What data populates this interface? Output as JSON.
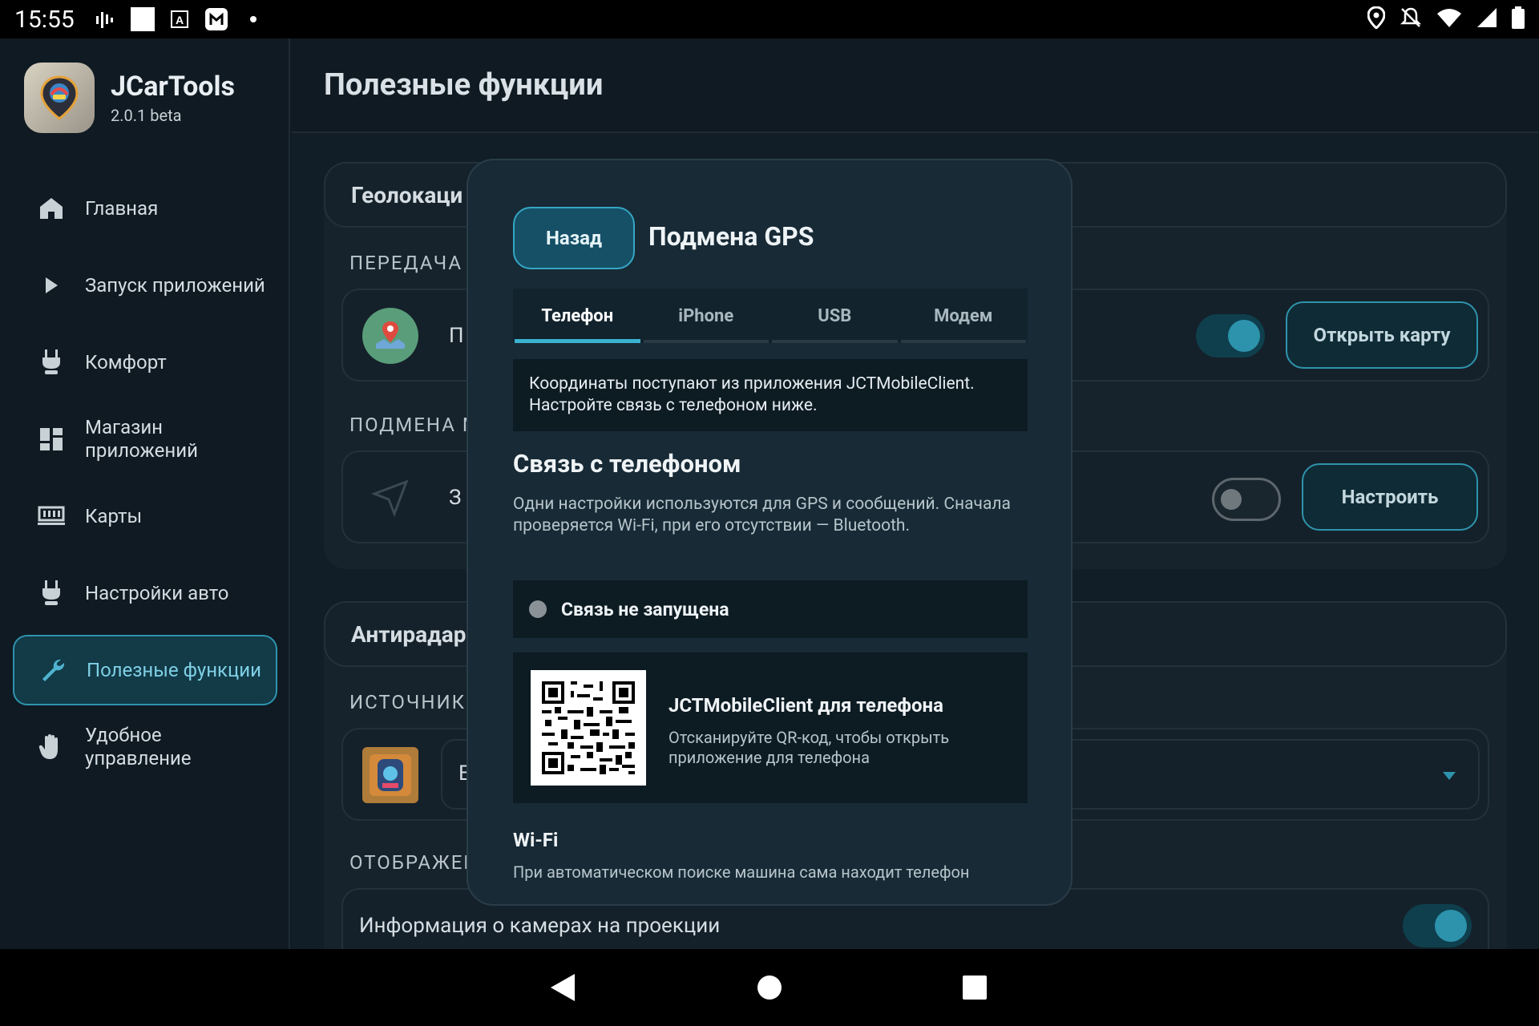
{
  "status_bar": {
    "time": "15:55"
  },
  "sidebar": {
    "app_name": "JCarTools",
    "version": "2.0.1 beta",
    "items": [
      {
        "label": "Главная",
        "icon": "home-icon"
      },
      {
        "label": "Запуск приложений",
        "icon": "play-icon"
      },
      {
        "label": "Комфорт",
        "icon": "seat-icon"
      },
      {
        "label": "Магазин\nприложений",
        "icon": "grid-icon"
      },
      {
        "label": "Карты",
        "icon": "map-icon"
      },
      {
        "label": "Настройки авто",
        "icon": "seat-icon"
      },
      {
        "label": "Полезные функции",
        "icon": "wrench-icon",
        "active": true
      },
      {
        "label": "Удобное\nуправление",
        "icon": "hand-icon"
      }
    ]
  },
  "main": {
    "title": "Полезные функции",
    "geo_card": {
      "header": "Геолокаци",
      "section1": "ПЕРЕДАЧА",
      "row1_text": "П",
      "row1_button": "Открыть карту",
      "section2": "ПОДМЕНА М",
      "row2_text": "З",
      "row2_button": "Настроить"
    },
    "radar_card": {
      "header": "Антирадар",
      "section1": "ИСТОЧНИК",
      "row1_text": "E",
      "section2": "ОТОБРАЖЕНИЕ ПРЕДУПРЕЖДЕНИЙ",
      "row2_text": "Информация о камерах на проекции"
    }
  },
  "dialog": {
    "back_label": "Назад",
    "title": "Подмена GPS",
    "tabs": [
      "Телефон",
      "iPhone",
      "USB",
      "Модем"
    ],
    "active_tab": 0,
    "info": "Координаты поступают из приложения JCTMobileClient. Настройте связь с телефоном ниже.",
    "heading": "Связь с телефоном",
    "description": "Одни настройки используются для GPS и сообщений. Сначала проверяется Wi-Fi, при его отсутствии — Bluetooth.",
    "status": "Связь не запущена",
    "qr_title": "JCTMobileClient для телефона",
    "qr_desc": "Отсканируйте QR-код, чтобы открыть приложение для телефона",
    "wifi_title": "Wi-Fi",
    "wifi_desc": "При автоматическом поиске машина сама находит телефон"
  },
  "colors": {
    "accent": "#2f93ad",
    "background": "#111e27",
    "dialog": "#172a36"
  }
}
